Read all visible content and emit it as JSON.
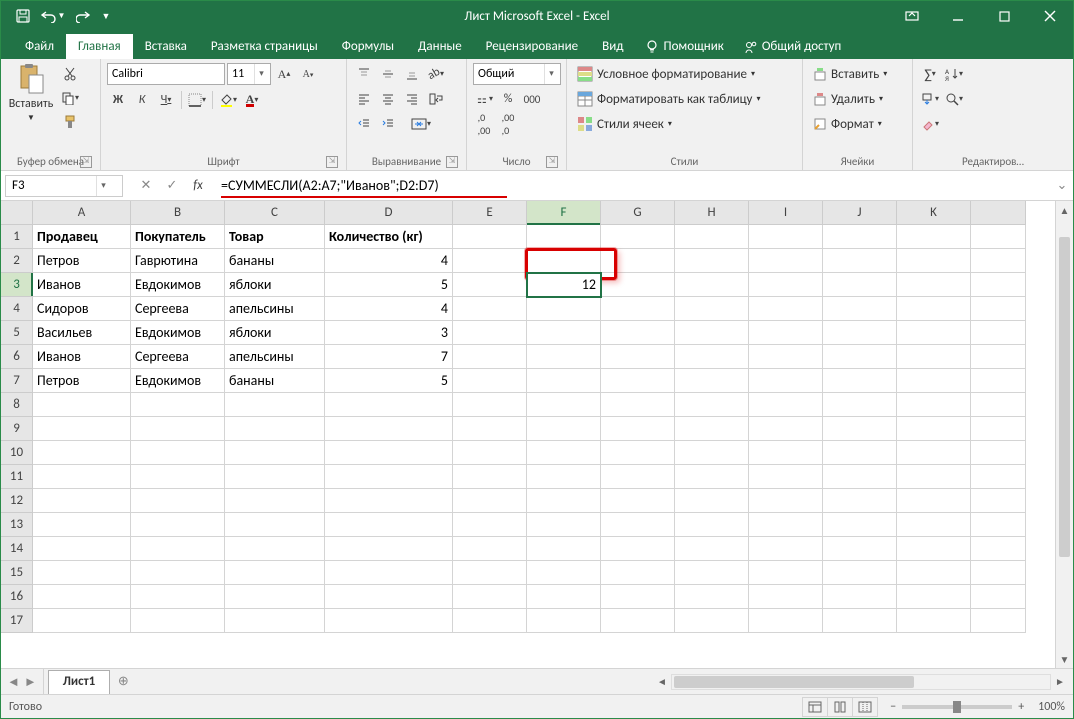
{
  "title": "Лист Microsoft Excel - Excel",
  "tabs": {
    "file": "Файл",
    "home": "Главная",
    "insert": "Вставка",
    "layout": "Разметка страницы",
    "formulas": "Формулы",
    "data": "Данные",
    "review": "Рецензирование",
    "view": "Вид",
    "helper": "Помощник",
    "share": "Общий доступ"
  },
  "ribbon": {
    "clipboard": {
      "paste": "Вставить",
      "label": "Буфер обмена"
    },
    "font": {
      "name": "Calibri",
      "size": "11",
      "label": "Шрифт",
      "bold": "Ж",
      "italic": "К",
      "underline": "Ч"
    },
    "alignment": {
      "label": "Выравнивание"
    },
    "number": {
      "format": "Общий",
      "label": "Число"
    },
    "styles": {
      "cond": "Условное форматирование",
      "table": "Форматировать как таблицу",
      "cell": "Стили ячеек",
      "label": "Стили"
    },
    "cells": {
      "insert": "Вставить",
      "delete": "Удалить",
      "format": "Формат",
      "label": "Ячейки"
    },
    "editing": {
      "label": "Редактиров…"
    }
  },
  "namebox": "F3",
  "formula": "=СУММЕСЛИ(A2:A7;\"Иванов\";D2:D7)",
  "columns": [
    "A",
    "B",
    "C",
    "D",
    "E",
    "F",
    "G",
    "H",
    "I",
    "J",
    "K",
    ""
  ],
  "rows_visible": 17,
  "active": {
    "col": "F",
    "row": 3
  },
  "headers": {
    "c1": "Продавец",
    "c2": "Покупатель",
    "c3": "Товар",
    "c4": "Количество (кг)"
  },
  "data_rows": [
    {
      "c1": "Петров",
      "c2": "Гаврютина",
      "c3": "бананы",
      "c4": "4"
    },
    {
      "c1": "Иванов",
      "c2": "Евдокимов",
      "c3": "яблоки",
      "c4": "5"
    },
    {
      "c1": "Сидоров",
      "c2": "Сергеева",
      "c3": "апельсины",
      "c4": "4"
    },
    {
      "c1": "Васильев",
      "c2": "Евдокимов",
      "c3": "яблоки",
      "c4": "3"
    },
    {
      "c1": "Иванов",
      "c2": "Сергеева",
      "c3": "апельсины",
      "c4": "7"
    },
    {
      "c1": "Петров",
      "c2": "Евдокимов",
      "c3": "бананы",
      "c4": "5"
    }
  ],
  "result_cell": "12",
  "sheet": "Лист1",
  "status": "Готово",
  "zoom": "100%"
}
